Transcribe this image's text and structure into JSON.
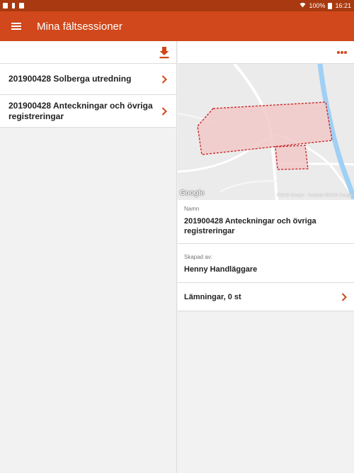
{
  "status_bar": {
    "battery": "100%",
    "time": "16:21"
  },
  "app_bar": {
    "title": "Mina fältsessioner",
    "menu_icon": "hamburger-menu-icon"
  },
  "left_pane": {
    "toolbar_icon": "download-icon",
    "sessions": [
      {
        "label": "201900428 Solberga utredning"
      },
      {
        "label": "201900428 Anteckningar och övriga registreringar"
      }
    ]
  },
  "right_pane": {
    "toolbar_icon": "more-options-icon",
    "map": {
      "logo": "Google",
      "attribution": "©2019 Google · Kartdata ©2019 Google"
    },
    "details": {
      "name_caption": "Namn",
      "name_value": "201900428 Anteckningar och övriga registreringar",
      "creator_caption": "Skapad av:",
      "creator_value": "Henny Handläggare",
      "remains_label": "Lämningar, 0 st"
    }
  },
  "colors": {
    "app_bar": "#d0481b",
    "status_bar": "#a83910",
    "accent": "#d0481b",
    "polygon_fill": "#f2c9c9",
    "polygon_stroke": "#c92a2a",
    "river": "#9fd0f5"
  }
}
